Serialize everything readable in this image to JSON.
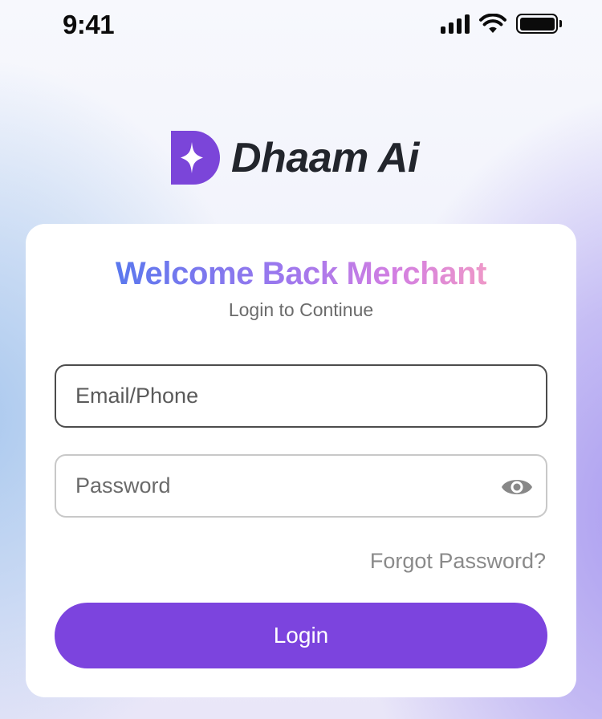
{
  "status_bar": {
    "time": "9:41",
    "icons": [
      "signal-icon",
      "wifi-icon",
      "battery-icon"
    ]
  },
  "brand": {
    "name": "Dhaam Ai",
    "logo_icon": "brand-logo-icon",
    "logo_color": "#7b45d9"
  },
  "login_card": {
    "title": "Welcome Back Merchant",
    "subtitle": "Login to Continue",
    "email_placeholder": "Email/Phone",
    "password_placeholder": "Password",
    "password_toggle_icon": "eye-icon",
    "forgot_password": "Forgot Password?",
    "login_label": "Login"
  },
  "colors": {
    "accent": "#7c44de",
    "title_gradient": [
      "#5a78ee",
      "#9c78ee",
      "#d27ee2",
      "#ee98c8"
    ]
  }
}
